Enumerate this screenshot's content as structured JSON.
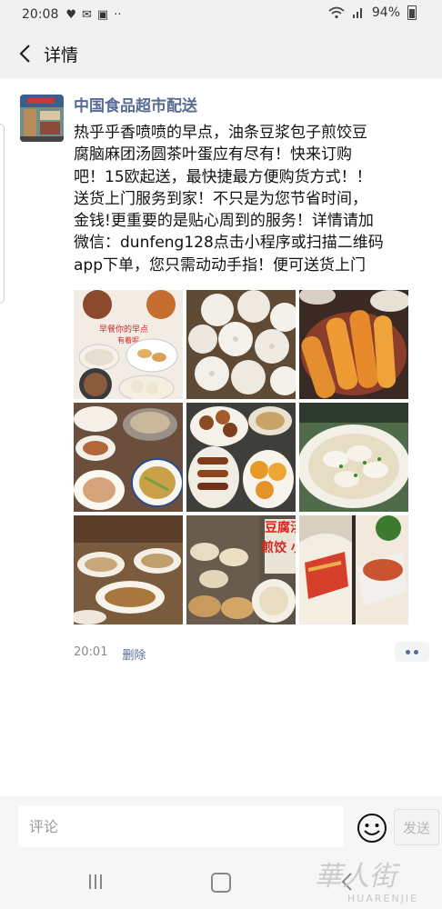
{
  "status_bar": {
    "time": "20:08",
    "battery": "94%"
  },
  "nav": {
    "title": "详情"
  },
  "post": {
    "author": "中国食品超市配送",
    "text_lines": [
      "热乎乎香喷喷的早点，油条豆浆包子煎饺豆",
      "腐脑麻团汤圆茶叶蛋应有尽有！快来订购",
      "吧！15欧起送，最快捷最方便购货方式！！",
      "送货上门服务到家！不只是为您节省时间，",
      "金钱!更重要的是贴心周到的服务！详情请加",
      "微信：dunfeng128点击小程序或扫描二维码",
      "app下单，您只需动动手指！便可送货上门"
    ],
    "time": "20:01",
    "delete_label": "删除",
    "image_captions": {
      "poster_line1": "早餐你的早点",
      "poster_line2": "有着呢",
      "banner_line1": "豆腐汤",
      "banner_line2": "煎饺 小"
    }
  },
  "comment_bar": {
    "placeholder": "评论",
    "send_label": "发送"
  },
  "watermark": {
    "chinese": "華人街",
    "latin": "HUARENJIE"
  },
  "icons": [
    "back-icon",
    "heart-icon",
    "mail-icon",
    "image-icon",
    "wifi-icon",
    "signal-icon",
    "battery-icon",
    "emoji-icon",
    "more-icon"
  ],
  "colors": {
    "link": "#576b95",
    "bar_bg": "#f1f1f1",
    "meta": "#888888"
  }
}
